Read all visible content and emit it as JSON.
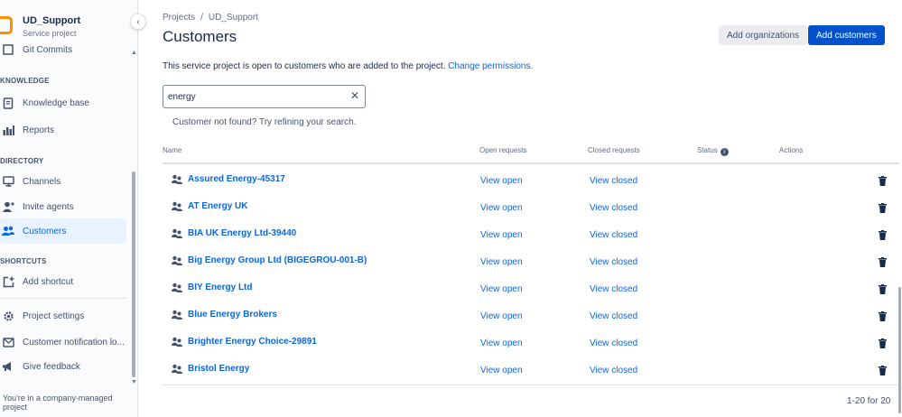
{
  "sidebar": {
    "project_name": "UD_Support",
    "project_type": "Service project",
    "top_items": [
      {
        "label": "Git Commits",
        "icon": "git-commits-icon"
      }
    ],
    "knowledge_header": "KNOWLEDGE",
    "knowledge_items": [
      {
        "label": "Knowledge base",
        "icon": "book-icon"
      },
      {
        "label": "Reports",
        "icon": "chart-icon"
      }
    ],
    "directory_header": "DIRECTORY",
    "directory_items": [
      {
        "label": "Channels",
        "icon": "monitor-icon"
      },
      {
        "label": "Invite agents",
        "icon": "person-add-icon"
      },
      {
        "label": "Customers",
        "icon": "people-icon",
        "active": true
      }
    ],
    "shortcuts_header": "SHORTCUTS",
    "shortcut_items": [
      {
        "label": "Add shortcut",
        "icon": "add-shortcut-icon"
      }
    ],
    "bottom_items": [
      {
        "label": "Project settings",
        "icon": "gear-icon"
      },
      {
        "label": "Customer notification lo...",
        "icon": "envelope-icon"
      },
      {
        "label": "Give feedback",
        "icon": "megaphone-icon"
      }
    ],
    "footnote": "You're in a company-managed project"
  },
  "breadcrumb": {
    "items": [
      "Projects",
      "UD_Support"
    ],
    "separator": "/"
  },
  "page": {
    "title": "Customers",
    "add_org_label": "Add organizations",
    "add_customers_label": "Add customers",
    "info_text": "This service project is open to customers who are added to the project.",
    "info_link": "Change permissions."
  },
  "search": {
    "value": "energy",
    "placeholder": ""
  },
  "not_found": "Customer not found? Try refining your search.",
  "table": {
    "headers": {
      "name": "Name",
      "open": "Open requests",
      "closed": "Closed requests",
      "status": "Status",
      "actions": "Actions"
    },
    "rows": [
      {
        "name": "Assured Energy-45317",
        "open": "View open",
        "closed": "View closed"
      },
      {
        "name": "AT Energy UK",
        "open": "View open",
        "closed": "View closed"
      },
      {
        "name": "BIA UK Energy Ltd-39440",
        "open": "View open",
        "closed": "View closed"
      },
      {
        "name": "Big Energy Group Ltd (BIGEGROU-001-B)",
        "open": "View open",
        "closed": "View closed"
      },
      {
        "name": "BIY Energy Ltd",
        "open": "View open",
        "closed": "View closed"
      },
      {
        "name": "Blue Energy Brokers",
        "open": "View open",
        "closed": "View closed"
      },
      {
        "name": "Brighter Energy Choice-29891",
        "open": "View open",
        "closed": "View closed"
      },
      {
        "name": "Bristol Energy",
        "open": "View open",
        "closed": "View closed"
      }
    ]
  },
  "pagination": "1-20 for 20",
  "colors": {
    "accent": "#0052cc",
    "link": "#0c66e4",
    "logo": "#ff8b00"
  }
}
